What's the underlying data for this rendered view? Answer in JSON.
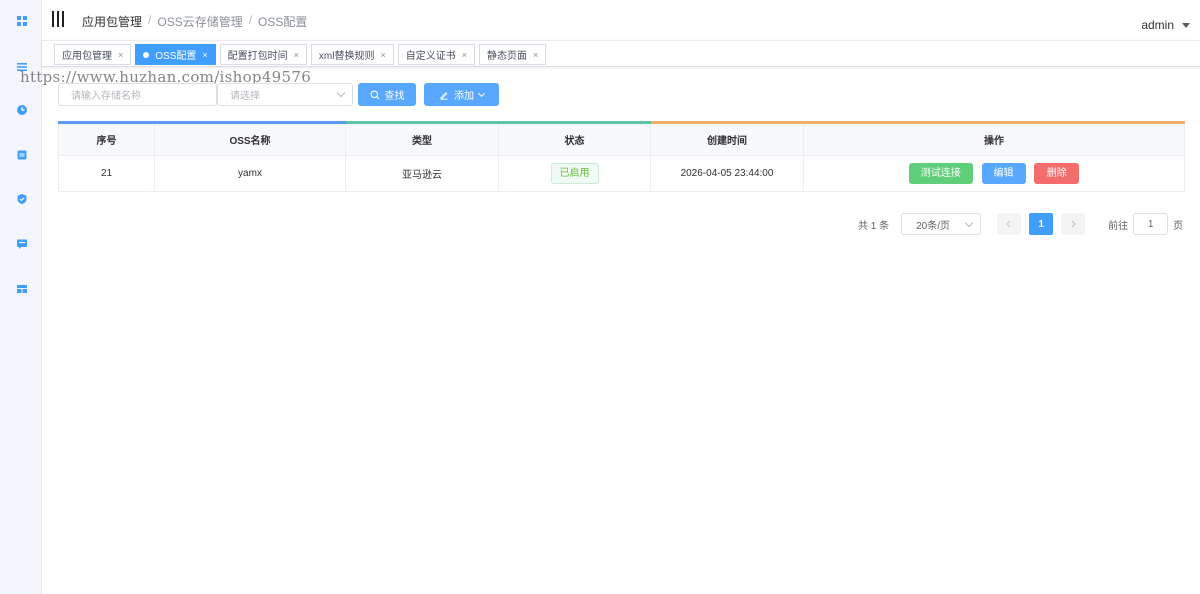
{
  "header": {
    "breadcrumb": [
      "应用包管理",
      "OSS云存储管理",
      "OSS配置"
    ],
    "separator": "/",
    "user": "admin"
  },
  "tabs": [
    {
      "label": "应用包管理",
      "active": false
    },
    {
      "label": "OSS配置",
      "active": true
    },
    {
      "label": "配置打包时间",
      "active": false
    },
    {
      "label": "xml替换规则",
      "active": false
    },
    {
      "label": "自定义证书",
      "active": false
    },
    {
      "label": "静态页面",
      "active": false
    }
  ],
  "tab_close": "×",
  "watermark": "https://www.huzhan.com/ishop49576",
  "filters": {
    "name_placeholder": "请输入存储名称",
    "select_placeholder": "请选择",
    "search_label": "查找",
    "add_label": "添加"
  },
  "table": {
    "columns": [
      "序号",
      "OSS名称",
      "类型",
      "状态",
      "创建时间",
      "操作"
    ],
    "column_colors": [
      "#5b9bf0",
      "#5b9bf0",
      "#5ec4a8",
      "#5ec4a8",
      "#f2ad6c",
      "#f2ad6c"
    ],
    "rows": [
      {
        "id": "21",
        "name": "yamx",
        "type": "亚马逊云",
        "status": "已启用",
        "created": "2026-04-05 23:44:00"
      }
    ],
    "actions": {
      "test": "测试连接",
      "edit": "编辑",
      "delete": "删除"
    }
  },
  "pagination": {
    "total": "共 1 条",
    "page_size": "20条/页",
    "current_page": "1",
    "goto_label": "前往",
    "goto_value": "1",
    "page_suffix": "页"
  },
  "colors": {
    "primary": "#409eff",
    "success": "#67c23a",
    "danger": "#f56c6c"
  },
  "sidebar_icons": [
    "dashboard-icon",
    "list-icon",
    "clock-icon",
    "card-icon",
    "shield-icon",
    "comment-icon",
    "layout-icon"
  ]
}
